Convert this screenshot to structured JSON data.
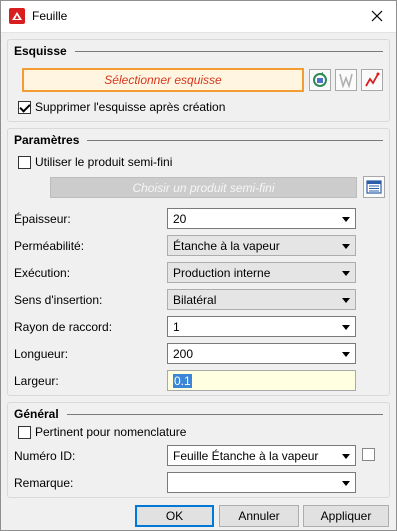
{
  "window": {
    "title": "Feuille"
  },
  "esquisse": {
    "title": "Esquisse",
    "select_label": "Sélectionner esquisse",
    "delete_sketch_label": "Supprimer l'esquisse après création",
    "delete_sketch_checked": true
  },
  "parametres": {
    "title": "Paramètres",
    "semi_finished_label": "Utiliser le produit semi-fini",
    "semi_finished_checked": false,
    "choose_semi_finished_label": "Choisir un produit semi-fini",
    "rows": [
      {
        "label": "Épaisseur:",
        "value": "20"
      },
      {
        "label": "Perméabilité:",
        "value": "Étanche à la vapeur"
      },
      {
        "label": "Exécution:",
        "value": "Production interne"
      },
      {
        "label": "Sens d'insertion:",
        "value": "Bilatéral"
      },
      {
        "label": "Rayon de raccord:",
        "value": "1"
      },
      {
        "label": "Longueur:",
        "value": "200"
      },
      {
        "label": "Largeur:",
        "value": "0.1"
      }
    ]
  },
  "general": {
    "title": "Général",
    "bom_label": "Pertinent pour nomenclature",
    "bom_checked": false,
    "id_label": "Numéro ID:",
    "id_value": "Feuille Étanche à la vapeur",
    "remark_label": "Remarque:",
    "remark_value": ""
  },
  "buttons": {
    "ok": "OK",
    "cancel": "Annuler",
    "apply": "Appliquer"
  },
  "colors": {
    "accent_orange": "#f39c33",
    "select_text": "#d4381e",
    "focus_yellow": "#ffffe1"
  }
}
